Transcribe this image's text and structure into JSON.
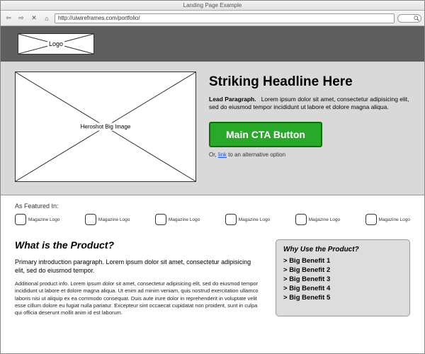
{
  "window": {
    "title": "Landing Page Example"
  },
  "browser": {
    "url": "http://uiwireframes.com/portfolio/"
  },
  "nav": {
    "logo_label": "Logo"
  },
  "hero": {
    "image_label": "Heroshot Big Image",
    "headline": "Striking Headline Here",
    "lead_label": "Lead Paragraph.",
    "lead_body": "Lorem ipsum dolor sit amet, consectetur adipisicing elit, sed do eiusmod tempor incididunt ut labore et dolore magna aliqua.",
    "cta_label": "Main CTA Button",
    "alt_prefix": "Or, ",
    "alt_link": "link",
    "alt_suffix": " to an alternative option"
  },
  "featured": {
    "title": "As Featured In:",
    "items": [
      "Magazine Logo",
      "Magazine Logo",
      "Magazine Logo",
      "Magazine Logo",
      "Magazine Logo",
      "Magazine Logo"
    ]
  },
  "product": {
    "heading": "What is the Product?",
    "para1": "Primary introduction paragraph. Lorem ipsum dolor sit amet, consectetur adipisicing elit, sed do eiusmod tempor.",
    "para2": "Additional product info. Lorem ipsum dolor sit amet, consectetur adipisicing elit, sed do eiusmod tempor incididunt ut labore et dolore magna aliqua. Ut enim ad minim veniam, quis nostrud exercitation ullamco laboris nisi ut aliquip ex ea commodo consequat. Duis aute irure dolor in reprehenderit in voluptate velit esse cillum dolore eu fugiat nulla pariatur. Excepteur sint occaecat cupidatat non proident, sunt in culpa qui officia deserunt mollit anim id est laborum."
  },
  "benefits": {
    "heading": "Why Use the Product?",
    "items": [
      "Big Benefit 1",
      "Big Benefit 2",
      "Big Benefit 3",
      "Big Benefit 4",
      "Big Benefit 5"
    ]
  }
}
